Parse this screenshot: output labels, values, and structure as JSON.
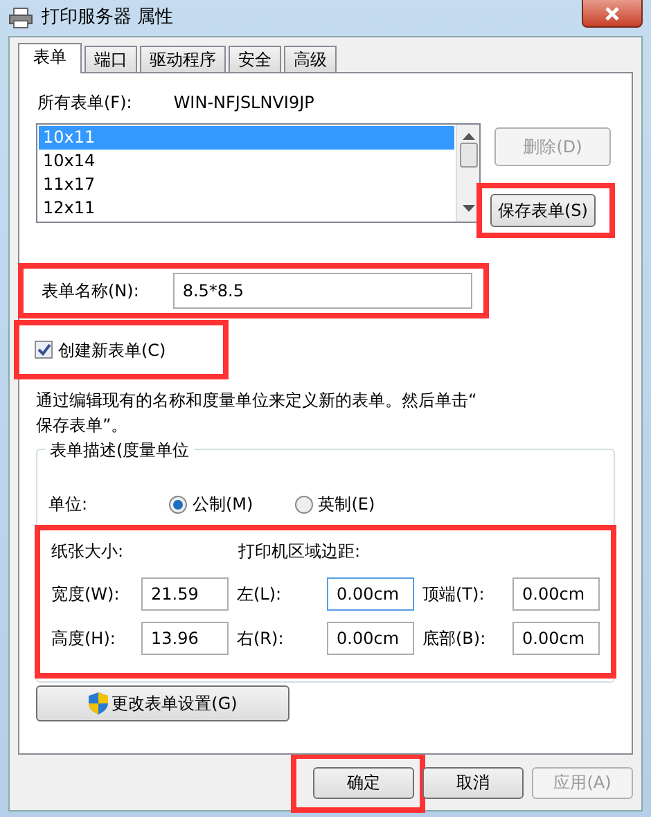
{
  "window": {
    "title": "打印服务器 属性"
  },
  "tabs": [
    {
      "label": "表单",
      "selected": true
    },
    {
      "label": "端口",
      "selected": false
    },
    {
      "label": "驱动程序",
      "selected": false
    },
    {
      "label": "安全",
      "selected": false
    },
    {
      "label": "高级",
      "selected": false
    }
  ],
  "forms_label": "所有表单(F):",
  "server_name": "WIN-NFJSLNVI9JP",
  "forms_list": [
    {
      "label": "10x11",
      "selected": true
    },
    {
      "label": "10x14",
      "selected": false
    },
    {
      "label": "11x17",
      "selected": false
    },
    {
      "label": "12x11",
      "selected": false
    }
  ],
  "side_buttons": [
    {
      "label": "删除(D)",
      "disabled": true,
      "highlighted": false
    },
    {
      "label": "保存表单(S)",
      "disabled": false,
      "highlighted": true
    }
  ],
  "form_name": {
    "label": "表单名称(N):",
    "value": "8.5*8.5",
    "highlighted": true
  },
  "create_new": {
    "label": "创建新表单(C)",
    "checked": true,
    "highlighted": true
  },
  "hint": "通过编辑现有的名称和度量单位来定义新的表单。然后单击“\n保存表单”。",
  "group": {
    "title": "表单描述(度量单位",
    "units_label": "单位:",
    "units": [
      {
        "label": "公制(M)",
        "selected": true
      },
      {
        "label": "英制(E)",
        "selected": false
      }
    ],
    "measure": {
      "highlighted": true,
      "paper_label": "纸张大小:",
      "margins_label": "打印机区域边距:",
      "rows": [
        [
          {
            "label": "宽度(W):",
            "value": "21.59",
            "focused": false
          },
          {
            "label": "左(L):",
            "value": "0.00cm",
            "focused": true
          },
          {
            "label": "顶端(T):",
            "value": "0.00cm",
            "focused": false
          }
        ],
        [
          {
            "label": "高度(H):",
            "value": "13.96",
            "focused": false
          },
          {
            "label": "右(R):",
            "value": "0.00cm",
            "focused": false
          },
          {
            "label": "底部(B):",
            "value": "0.00cm",
            "focused": false
          }
        ]
      ]
    }
  },
  "change_button": "更改表单设置(G)",
  "dialog_buttons": [
    {
      "label": "确定",
      "disabled": false,
      "highlighted": true
    },
    {
      "label": "取消",
      "disabled": false,
      "highlighted": false
    },
    {
      "label": "应用(A)",
      "disabled": true,
      "highlighted": false
    }
  ]
}
